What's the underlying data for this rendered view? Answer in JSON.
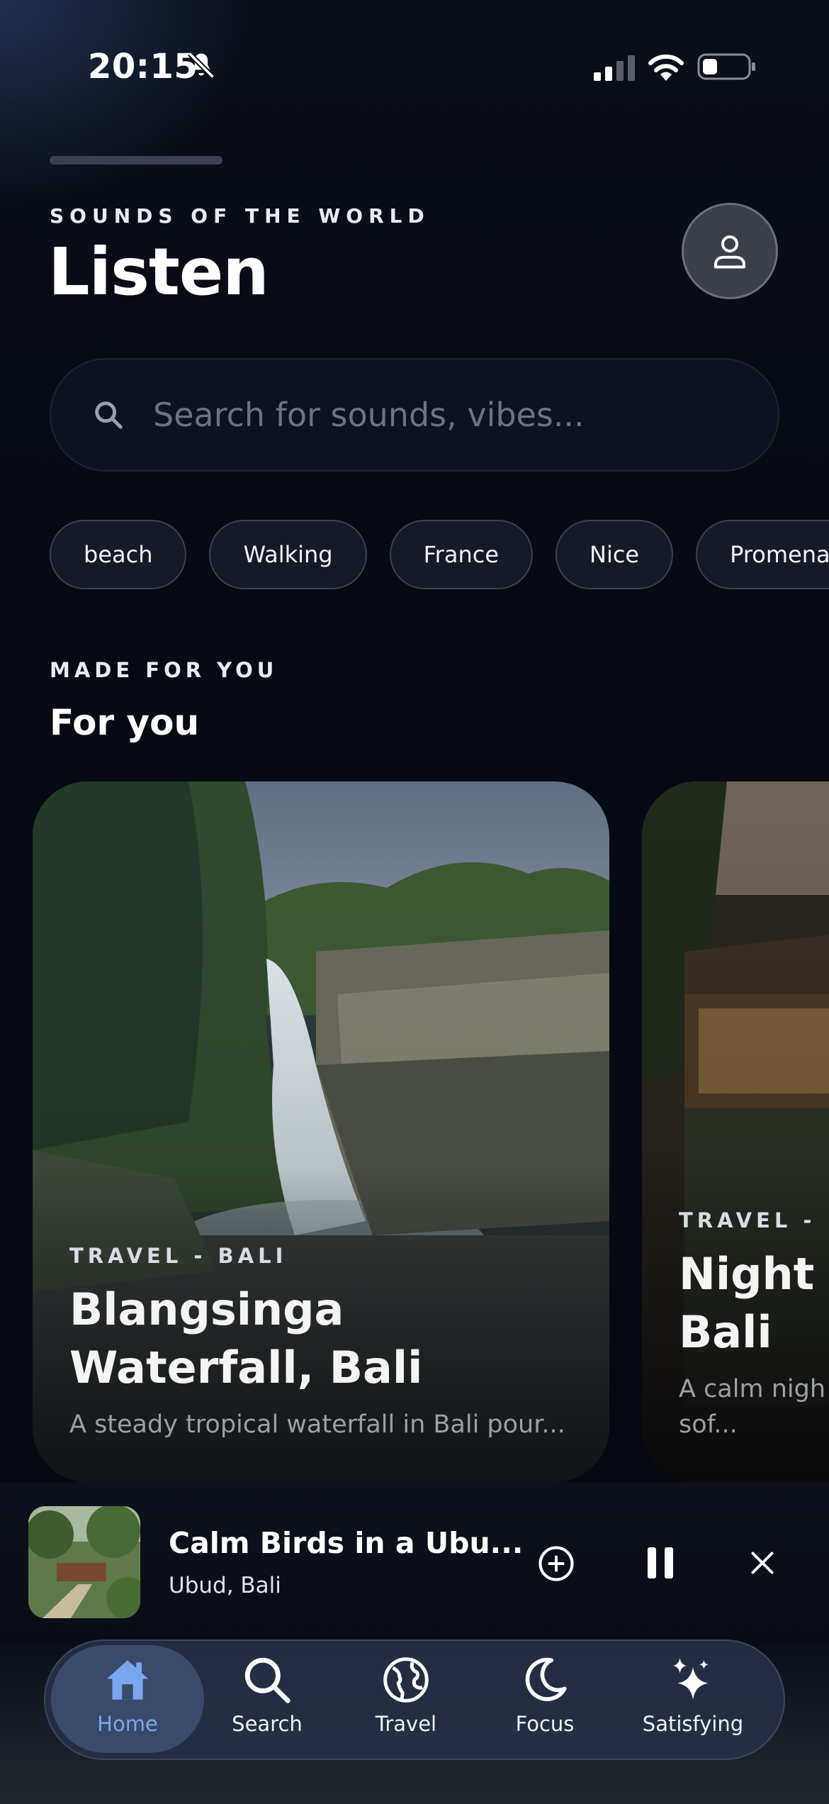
{
  "status_bar": {
    "time": "20:15"
  },
  "header": {
    "eyebrow": "SOUNDS OF THE WORLD",
    "title": "Listen"
  },
  "search": {
    "placeholder": "Search for sounds, vibes..."
  },
  "chips": [
    "beach",
    "Walking",
    "France",
    "Nice",
    "Promenade"
  ],
  "section": {
    "eyebrow": "MADE FOR YOU",
    "title": "For you"
  },
  "cards": [
    {
      "category": "TRAVEL - BALI",
      "title": "Blangsinga Waterfall, Bali",
      "description": "A steady tropical waterfall in Bali pour..."
    },
    {
      "category": "TRAVEL - B",
      "title": "Night a Bali",
      "description": "A calm nigh sof..."
    }
  ],
  "mini_player": {
    "title": "Calm Birds in a Ubu...",
    "subtitle": "Ubud, Bali"
  },
  "tabs": [
    {
      "label": "Home",
      "icon": "home-icon",
      "active": true
    },
    {
      "label": "Search",
      "icon": "search-icon",
      "active": false
    },
    {
      "label": "Travel",
      "icon": "globe-icon",
      "active": false
    },
    {
      "label": "Focus",
      "icon": "moon-icon",
      "active": false
    },
    {
      "label": "Satisfying",
      "icon": "sparkles-icon",
      "active": false
    }
  ],
  "colors": {
    "background": "#070a12",
    "accent": "#7aa6ee",
    "tabbar": "#263046"
  }
}
